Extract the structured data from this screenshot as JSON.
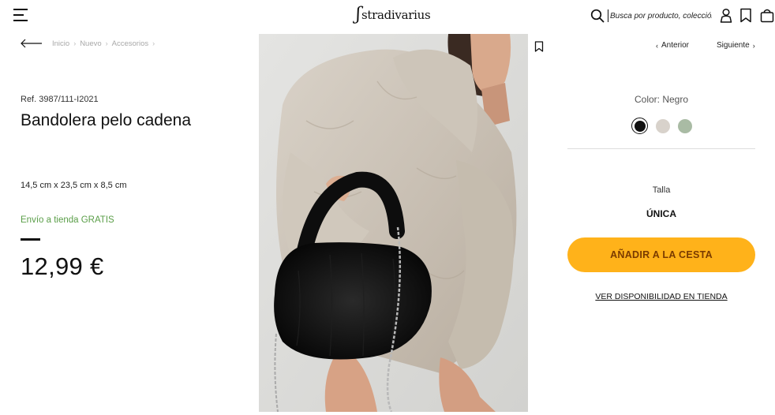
{
  "header": {
    "logo_text": "stradivarius",
    "search_placeholder": "Busca por producto, colección..."
  },
  "breadcrumb": [
    "Inicio",
    "Nuevo",
    "Accesorios"
  ],
  "product": {
    "ref": "Ref. 3987/111-I2021",
    "title": "Bandolera pelo cadena",
    "dimensions": "14,5 cm x 23,5 cm x 8,5 cm",
    "shipping": "Envío a tienda GRATIS",
    "price": "12,99 €"
  },
  "navigation": {
    "prev_label": "Anterior",
    "next_label": "Siguiente"
  },
  "color": {
    "label": "Color: Negro",
    "swatches": [
      {
        "name": "Negro",
        "hex": "#111111",
        "selected": true
      },
      {
        "name": "Beige",
        "hex": "#d8d2cb",
        "selected": false
      },
      {
        "name": "Verde",
        "hex": "#a9bba4",
        "selected": false
      }
    ]
  },
  "size": {
    "label": "Talla",
    "value": "ÚNICA"
  },
  "actions": {
    "add_to_cart": "AÑADIR A LA CESTA",
    "check_availability": "VER DISPONIBILIDAD EN TIENDA"
  },
  "colors": {
    "accent": "#ffb21a",
    "shipping_green": "#5a9e48"
  }
}
